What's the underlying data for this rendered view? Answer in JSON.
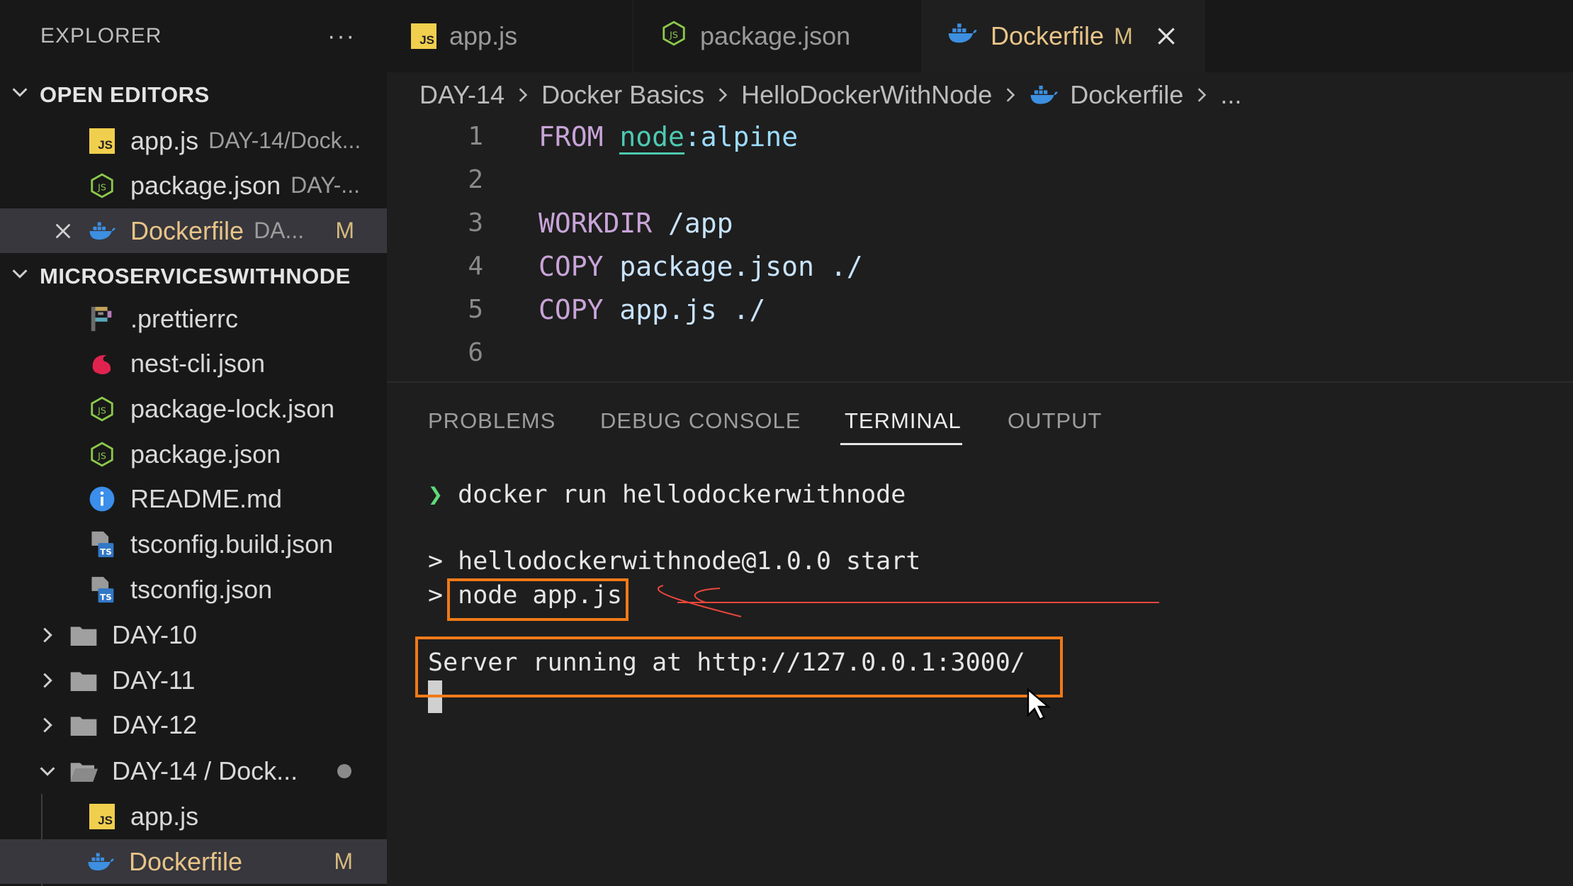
{
  "sidebar": {
    "title": "EXPLORER",
    "more": "···",
    "open_editors": {
      "title": "OPEN EDITORS",
      "items": [
        {
          "label": "app.js",
          "desc": "DAY-14/Dock...",
          "icon": "js-file-icon"
        },
        {
          "label": "package.json",
          "desc": "DAY-...",
          "icon": "nodejs-icon"
        },
        {
          "label": "Dockerfile",
          "desc": "DA...",
          "badge": "M",
          "icon": "docker-icon"
        }
      ]
    },
    "workspace": {
      "title": "MICROSERVICESWITHNODE",
      "files": [
        {
          "label": ".prettierrc",
          "icon": "prettier-icon"
        },
        {
          "label": "nest-cli.json",
          "icon": "nestjs-icon"
        },
        {
          "label": "package-lock.json",
          "icon": "nodejs-icon"
        },
        {
          "label": "package.json",
          "icon": "nodejs-icon"
        },
        {
          "label": "README.md",
          "icon": "info-icon"
        },
        {
          "label": "tsconfig.build.json",
          "icon": "tsconfig-icon"
        },
        {
          "label": "tsconfig.json",
          "icon": "tsconfig-icon"
        }
      ],
      "folders": [
        {
          "label": "DAY-10"
        },
        {
          "label": "DAY-11"
        },
        {
          "label": "DAY-12"
        },
        {
          "label": "DAY-14 / Dock..."
        }
      ],
      "day14_children": [
        {
          "label": "app.js",
          "icon": "js-file-icon"
        },
        {
          "label": "Dockerfile",
          "badge": "M",
          "icon": "docker-icon"
        }
      ]
    }
  },
  "tabs": [
    {
      "label": "app.js",
      "icon": "js-file-icon"
    },
    {
      "label": "package.json",
      "icon": "nodejs-icon"
    },
    {
      "label": "Dockerfile",
      "badge": "M",
      "icon": "docker-icon",
      "active": true
    }
  ],
  "breadcrumb": [
    "DAY-14",
    "Docker Basics",
    "HelloDockerWithNode",
    "Dockerfile",
    "..."
  ],
  "editor": {
    "lines": [
      {
        "n": "1",
        "kw": "FROM",
        "image": "node",
        "rest": ":alpine"
      },
      {
        "n": "2"
      },
      {
        "n": "3",
        "kw": "WORKDIR",
        "arg": "/app"
      },
      {
        "n": "4",
        "kw": "COPY",
        "arg": "package.json ./"
      },
      {
        "n": "5",
        "kw": "COPY",
        "arg": "app.js ./"
      },
      {
        "n": "6"
      }
    ]
  },
  "panel": {
    "tabs": [
      "PROBLEMS",
      "DEBUG CONSOLE",
      "TERMINAL",
      "OUTPUT"
    ],
    "active_tab": "TERMINAL",
    "terminal": {
      "prompt_symbol": "❯",
      "command": "docker run hellodockerwithnode",
      "line1_prefix": ">",
      "line1_text": "hellodockerwithnode@1.0.0 start",
      "line2_prefix": ">",
      "line2_text": "node app.js",
      "server_line": "Server running at http://127.0.0.1:3000/"
    }
  },
  "colors": {
    "accent_highlight": "#f07a18",
    "annotation_red": "#e8453c",
    "modified": "#d7ba7d",
    "prompt_green": "#5fd97a"
  }
}
